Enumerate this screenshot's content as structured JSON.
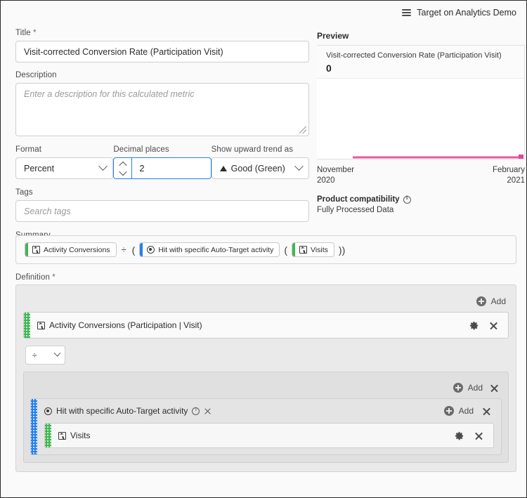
{
  "topbar": {
    "icon": "stack-icon",
    "label": "Target on Analytics Demo"
  },
  "form": {
    "title_label": "Title",
    "title_required": "*",
    "title_value": "Visit-corrected Conversion Rate (Participation Visit)",
    "description_label": "Description",
    "description_placeholder": "Enter a description for this calculated metric",
    "format_label": "Format",
    "format_value": "Percent",
    "decimal_label": "Decimal places",
    "decimal_value": "2",
    "trend_label": "Show upward trend as",
    "trend_value": "Good (Green)",
    "tags_label": "Tags",
    "tags_placeholder": "Search tags",
    "summary_label": "Summary",
    "definition_label": "Definition",
    "definition_required": "*"
  },
  "summary": {
    "chip1": "Activity Conversions",
    "op": "÷",
    "paren_open1": "(",
    "chip2": "Hit with specific Auto-Target activity",
    "paren_open2": "(",
    "chip3": "Visits",
    "paren_close": "))"
  },
  "definition": {
    "add_label": "Add",
    "item1": "Activity Conversions (Participation | Visit)",
    "operator": "÷",
    "nested_add_label": "Add",
    "segment_title": "Hit with specific Auto-Target activity",
    "segment_add_label": "Add",
    "item2": "Visits"
  },
  "preview": {
    "title": "Preview",
    "metric_name": "Visit-corrected Conversion Rate (Participation Visit)",
    "metric_value": "0",
    "axis_start_month": "November",
    "axis_start_year": "2020",
    "axis_end_month": "February",
    "axis_end_year": "2021",
    "compat_title": "Product compatibility",
    "compat_value": "Fully Processed Data"
  },
  "colors": {
    "accent_magenta": "#d23ccc",
    "chart_line": "#e8589f",
    "metric_green": "#44b556",
    "segment_blue": "#2680eb",
    "focus_blue": "#2680eb"
  }
}
